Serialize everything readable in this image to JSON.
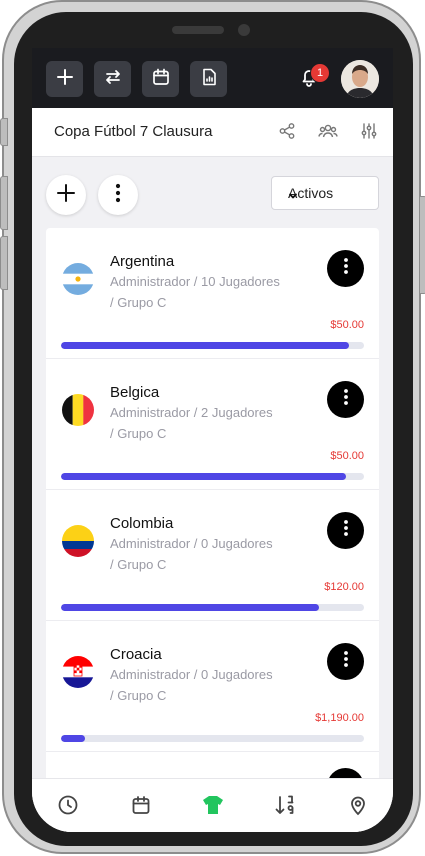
{
  "toolbar": {
    "buttons": [
      {
        "icon": "plus-icon"
      },
      {
        "icon": "swap-icon"
      },
      {
        "icon": "calendar-icon"
      },
      {
        "icon": "report-icon"
      }
    ],
    "notification_count": "1",
    "bell_icon": "bell-icon"
  },
  "header": {
    "title": "Copa Fútbol 7 Clausura",
    "icons": [
      "share-icon",
      "group-icon",
      "filters-icon"
    ]
  },
  "actions": {
    "add_icon": "plus-icon",
    "more_icon": "more-vertical-icon",
    "filter_selected": "Activos"
  },
  "teams": [
    {
      "name": "Argentina",
      "role_line": "Administrador / 10 Jugadores",
      "group_line": "/ Grupo C",
      "amount": "$50.00",
      "progress": 0.95,
      "flag": "argentina"
    },
    {
      "name": "Belgica",
      "role_line": "Administrador / 2 Jugadores",
      "group_line": "/ Grupo C",
      "amount": "$50.00",
      "progress": 0.94,
      "flag": "belgium"
    },
    {
      "name": "Colombia",
      "role_line": "Administrador / 0 Jugadores",
      "group_line": "/ Grupo C",
      "amount": "$120.00",
      "progress": 0.85,
      "flag": "colombia"
    },
    {
      "name": "Croacia",
      "role_line": "Administrador / 0 Jugadores",
      "group_line": "/ Grupo C",
      "amount": "$1,190.00",
      "progress": 0.08,
      "flag": "croatia"
    }
  ],
  "bottom_nav": [
    {
      "icon": "clock-icon"
    },
    {
      "icon": "calendar-icon"
    },
    {
      "icon": "jersey-icon",
      "active": true
    },
    {
      "icon": "sort-icon"
    },
    {
      "icon": "location-icon"
    }
  ],
  "colors": {
    "accent": "#4f46e5",
    "amount": "#e53935",
    "active_nav": "#22c55e",
    "topbar": "#1a1b1f"
  }
}
